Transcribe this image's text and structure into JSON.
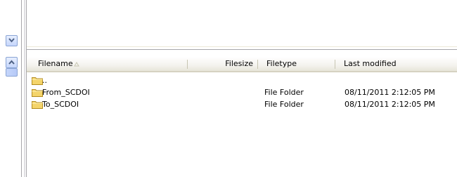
{
  "header": {
    "filename": "Filename",
    "filesize": "Filesize",
    "filetype": "Filetype",
    "last_modified": "Last modified"
  },
  "files": [
    {
      "name": "..",
      "type": "",
      "modified": ""
    },
    {
      "name": "From_SCDOI",
      "type": "File Folder",
      "modified": "08/11/2011 2:12:05 PM"
    },
    {
      "name": "To_SCDOI",
      "type": "File Folder",
      "modified": "08/11/2011 2:12:05 PM"
    }
  ],
  "icons": {
    "folder": "folder-icon",
    "scroll_down": "chevron-down-icon",
    "scroll_up": "chevron-up-icon",
    "sort": "sort-ascending-icon"
  },
  "colors": {
    "scroll_button": "#c5d6fb",
    "folder_yellow": "#f4d46a",
    "header_bg": "#f4f3ee"
  }
}
